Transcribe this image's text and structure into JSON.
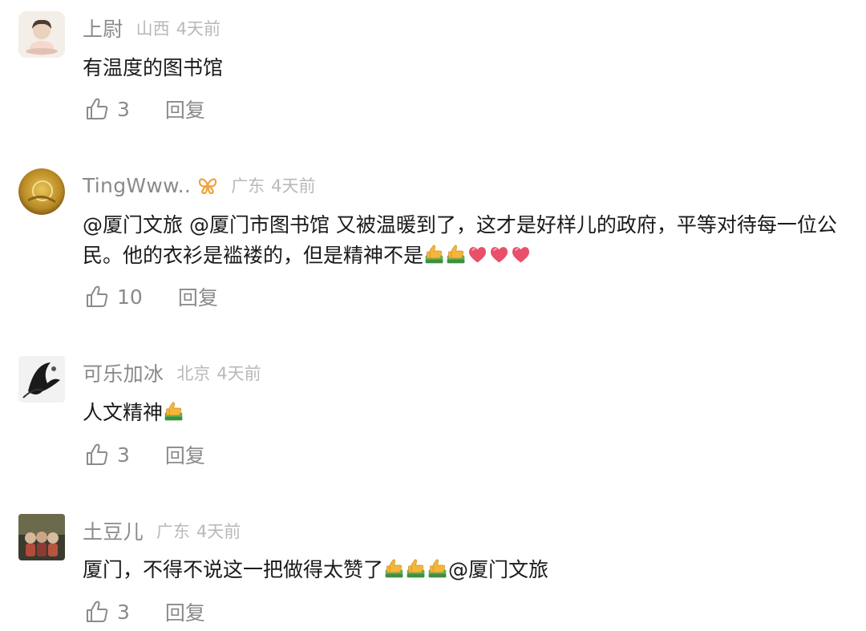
{
  "comments": [
    {
      "username": "上尉",
      "location": "山西",
      "time": "4天前",
      "text": "有温度的图书馆",
      "likes": "3",
      "reply_label": "回复"
    },
    {
      "username": "TingWww..",
      "vip_badge_icon": "vip-butterfly-icon",
      "location": "广东",
      "time": "4天前",
      "text_line1": "@厦门文旅 @厦门市图书馆 又被温暖到了，这才是好样儿的政府，平等对待每一位公",
      "text_line2": "民。他的衣衫是褴褛的，但是精神不是",
      "emojis": [
        "thumbs-up",
        "thumbs-up",
        "heart",
        "heart",
        "heart"
      ],
      "likes": "10",
      "reply_label": "回复"
    },
    {
      "username": "可乐加冰",
      "location": "北京",
      "time": "4天前",
      "text": "人文精神",
      "emojis": [
        "thumbs-up"
      ],
      "likes": "3",
      "reply_label": "回复"
    },
    {
      "username": "土豆儿",
      "location": "广东",
      "time": "4天前",
      "text_before": "厦门，不得不说这一把做得太赞了",
      "emojis": [
        "thumbs-up",
        "thumbs-up",
        "thumbs-up"
      ],
      "text_after": "@厦门文旅",
      "likes": "3",
      "reply_label": "回复"
    }
  ],
  "colors": {
    "username": "#8a8a8a",
    "meta": "#b9b9b9",
    "text": "#1a1a1a",
    "vip_badge": "#f0a23a",
    "heart": "#e8506a",
    "thumb": "#f4b63a"
  }
}
